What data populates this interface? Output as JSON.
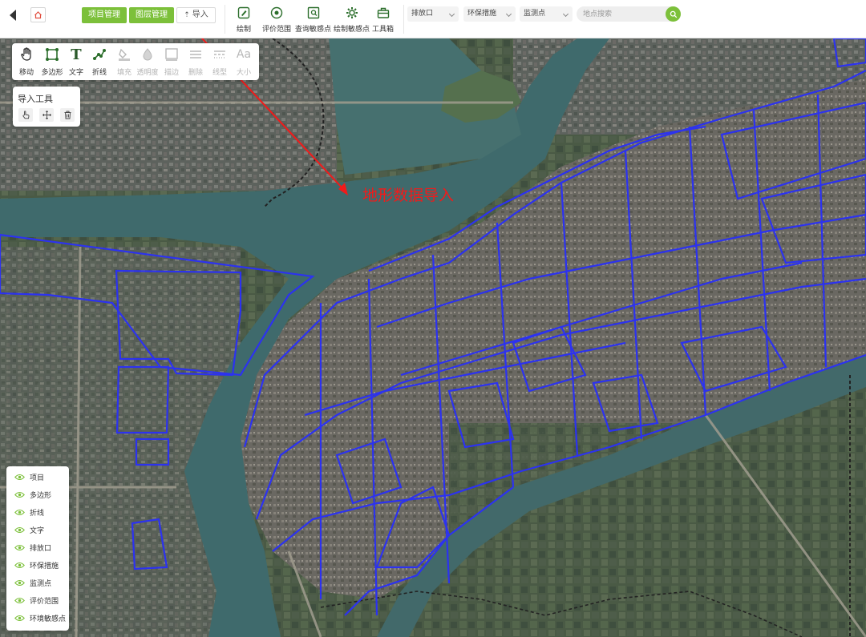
{
  "header": {
    "project_button": "项目管理",
    "layer_button": "图层管理",
    "import_button": "导入",
    "tools": [
      {
        "label": "绘制",
        "icon": "pen-icon"
      },
      {
        "label": "评价范围",
        "icon": "target-icon"
      },
      {
        "label": "查询敏感点",
        "icon": "query-icon"
      },
      {
        "label": "绘制敏感点",
        "icon": "gear-icon"
      },
      {
        "label": "工具箱",
        "icon": "toolbox-icon"
      }
    ],
    "selects": [
      "排放口",
      "环保措施",
      "监测点"
    ],
    "search_placeholder": "地点搜索"
  },
  "drawbox": {
    "tools": [
      {
        "label": "移动",
        "icon": "hand-icon",
        "enabled": true
      },
      {
        "label": "多边形",
        "icon": "polygon-icon",
        "enabled": true
      },
      {
        "label": "文字",
        "icon": "text-icon",
        "enabled": true
      },
      {
        "label": "折线",
        "icon": "polyline-icon",
        "enabled": true
      },
      {
        "label": "填充",
        "icon": "fill-icon",
        "enabled": false
      },
      {
        "label": "透明度",
        "icon": "opacity-icon",
        "enabled": false
      },
      {
        "label": "描边",
        "icon": "stroke-icon",
        "enabled": false
      },
      {
        "label": "删除",
        "icon": "delete-lines-icon",
        "enabled": false
      },
      {
        "label": "线型",
        "icon": "linetype-icon",
        "enabled": false
      },
      {
        "label": "大小",
        "icon": "font-size-icon",
        "enabled": false
      }
    ]
  },
  "import_tool": {
    "title": "导入工具",
    "buttons": [
      "pointer-icon",
      "move-icon",
      "trash-icon"
    ]
  },
  "layers": [
    "项目",
    "多边形",
    "折线",
    "文字",
    "排放口",
    "环保措施",
    "监测点",
    "评价范围",
    "环境敏感点"
  ],
  "annotation": {
    "text": "地形数据导入"
  },
  "colors": {
    "accent_green": "#7cc03a",
    "polygon_blue": "#2c32f0",
    "annotation_red": "#f21a1a",
    "river": "#3f6a6c",
    "land": "#4b5a48"
  }
}
